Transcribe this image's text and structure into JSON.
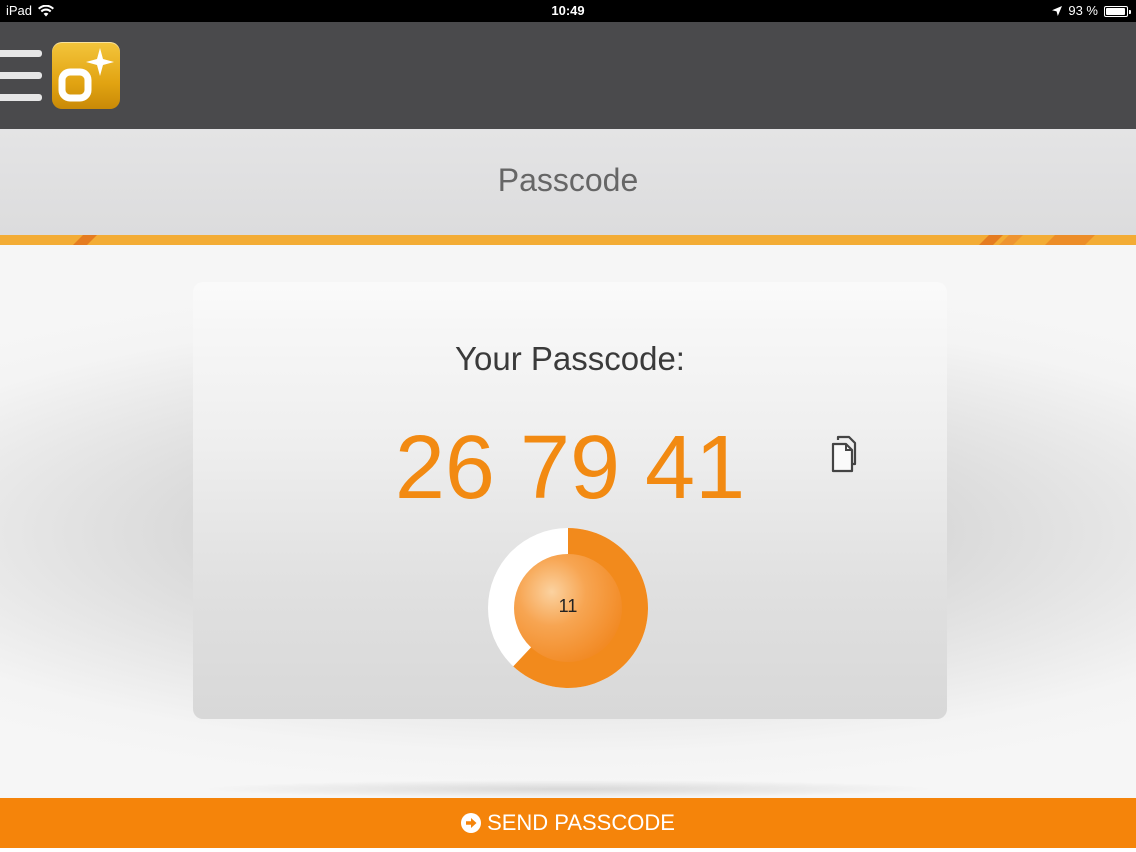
{
  "status_bar": {
    "device": "iPad",
    "time": "10:49",
    "battery_percent": "93 %",
    "battery_level": 0.93,
    "icons": [
      "wifi-icon",
      "location-arrow-icon",
      "battery-icon"
    ]
  },
  "header": {
    "menu_icon": "hamburger-menu-icon",
    "logo_icon": "app-logo-icon"
  },
  "page": {
    "title": "Passcode"
  },
  "card": {
    "heading": "Your Passcode:",
    "passcode": "26 79 41",
    "copy_icon": "copy-icon",
    "timer": {
      "seconds_remaining": "11",
      "remaining_fraction": 0.62
    }
  },
  "footer": {
    "send_label": "SEND PASSCODE",
    "send_icon": "arrow-circle-right-icon"
  },
  "colors": {
    "accent": "#f5840a",
    "passcode_text": "#f28a12",
    "header_bg": "#4a4a4c",
    "stripe": "#f3ac35",
    "logo_gold": "#e2a412"
  }
}
